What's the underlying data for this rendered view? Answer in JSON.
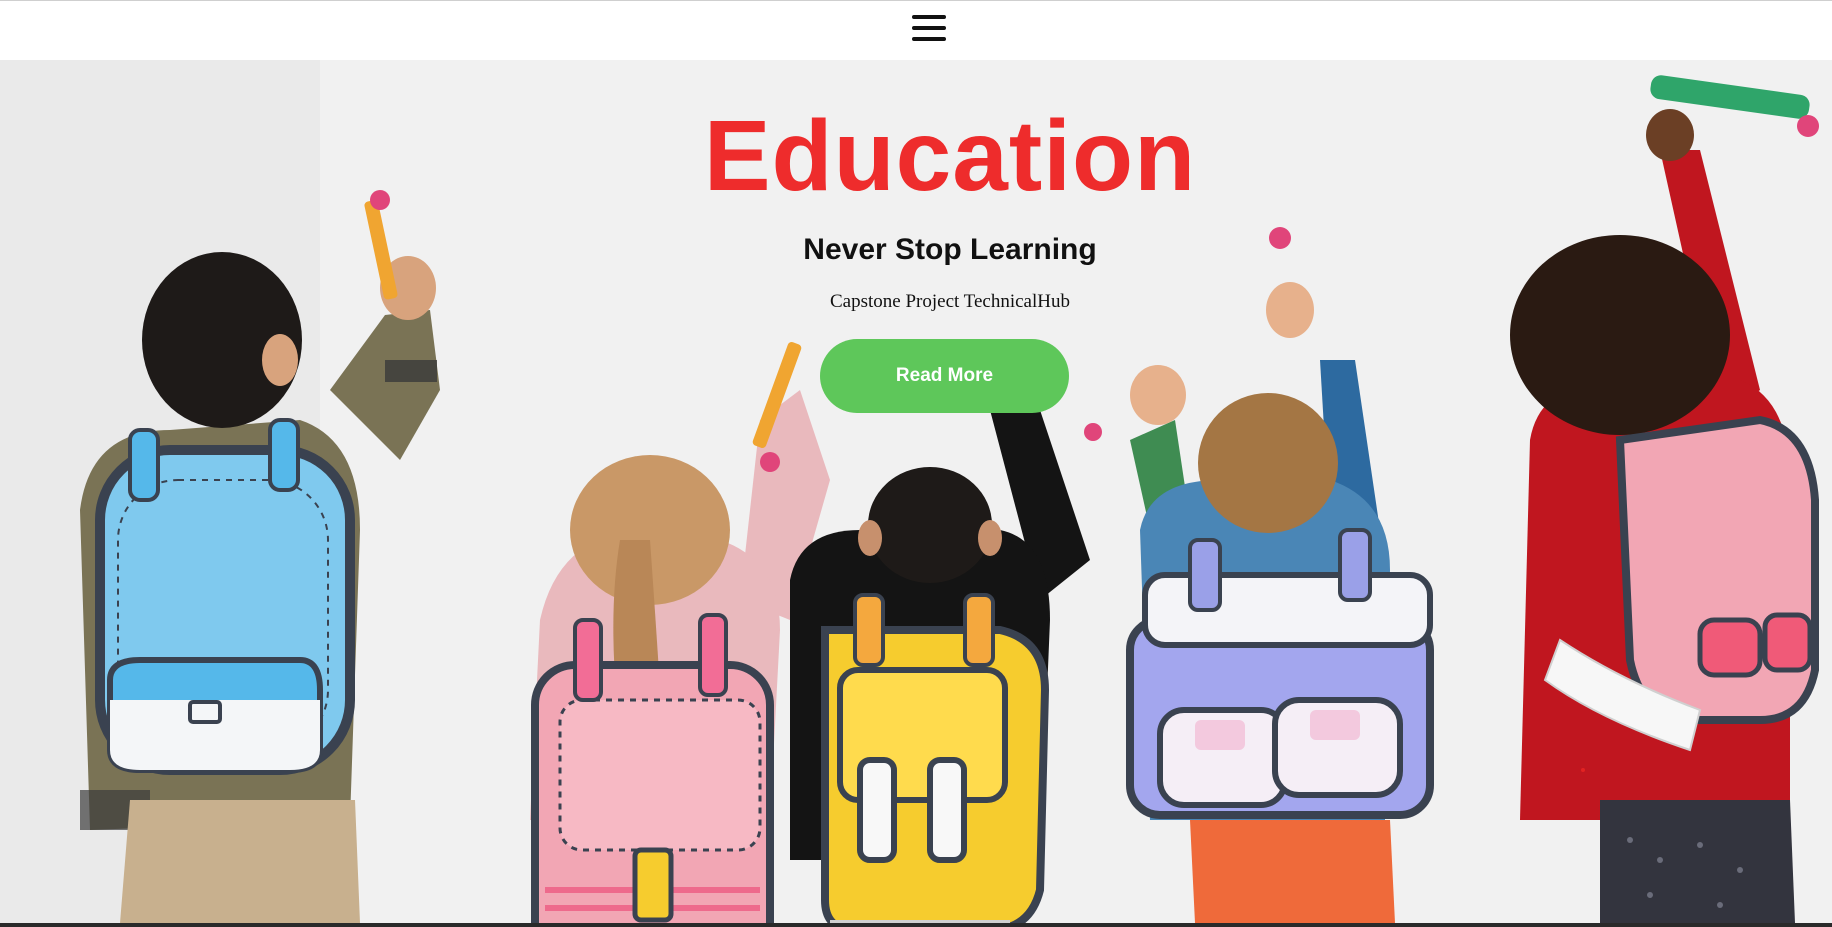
{
  "nav": {
    "menu_icon": "hamburger-menu-icon"
  },
  "hero": {
    "title": "Education",
    "subtitle": "Never Stop Learning",
    "caption": "Capstone Project TechnicalHub",
    "button_label": "Read More",
    "background_image": "children-with-backpacks-drawing-on-wall",
    "colors": {
      "title": "#ee2c2c",
      "button": "#5ec75a",
      "button_text": "#ffffff"
    }
  }
}
